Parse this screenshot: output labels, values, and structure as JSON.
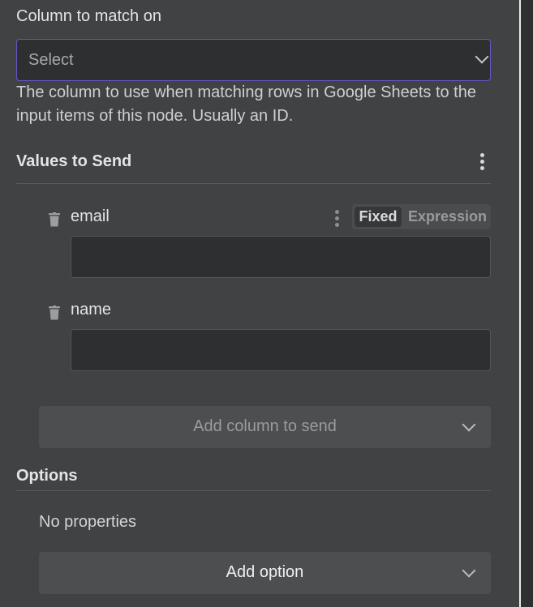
{
  "column_match": {
    "label": "Column to match on",
    "select_value": "Select",
    "help_text": "The column to use when matching rows in Google Sheets to the input items of this node. Usually an ID."
  },
  "values_to_send": {
    "title": "Values to Send",
    "fields": [
      {
        "name": "email",
        "mode_fixed": "Fixed",
        "mode_expression": "Expression",
        "value": ""
      },
      {
        "name": "name",
        "value": ""
      }
    ],
    "add_column_label": "Add column to send"
  },
  "options": {
    "title": "Options",
    "empty_text": "No properties",
    "add_option_label": "Add option"
  },
  "colors": {
    "panel_bg": "#414244",
    "input_bg": "#2e2f30",
    "focus_border": "#6556c9",
    "button_bg": "#4d4e50"
  },
  "icons": [
    "chevron-down-icon",
    "kebab-menu-icon",
    "trash-icon"
  ]
}
